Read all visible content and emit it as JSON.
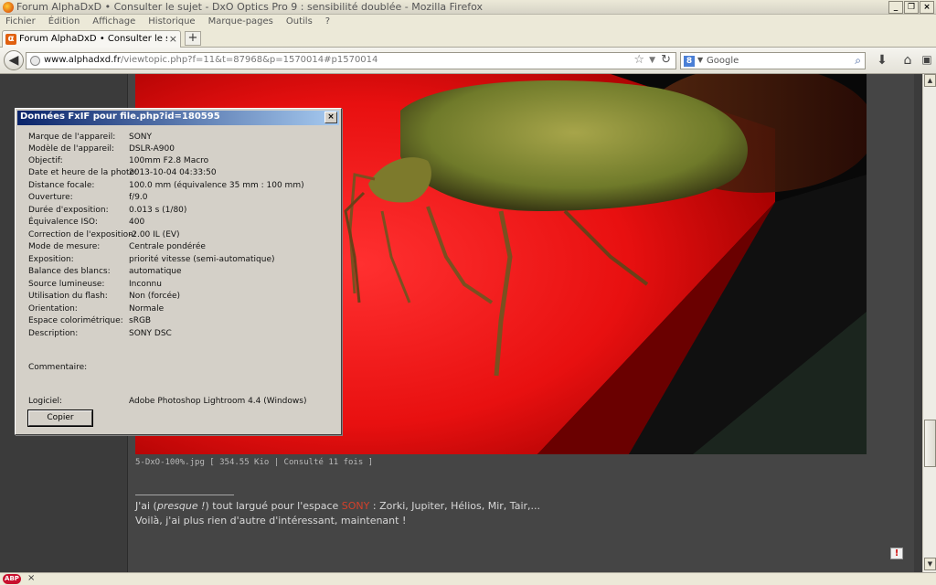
{
  "window": {
    "title": "Forum AlphaDxD • Consulter le sujet - DxO Optics Pro 9 : sensibilité doublée - Mozilla Firefox",
    "min_label": "_",
    "max_label": "❐",
    "close_label": "×"
  },
  "menu": {
    "items": [
      "Fichier",
      "Édition",
      "Affichage",
      "Historique",
      "Marque-pages",
      "Outils",
      "?"
    ]
  },
  "tab": {
    "label": "Forum AlphaDxD • Consulter le sujet - DxO ...",
    "favicon": "α",
    "close": "×",
    "new_tab": "+"
  },
  "nav": {
    "url_domain": "www.alphadxd.fr",
    "url_path": "/viewtopic.php?f=11&t=87968&p=1570014#p1570014",
    "search_engine": "8",
    "search_placeholder": "Google"
  },
  "dialog": {
    "title": "Données FxIF pour file.php?id=180595",
    "close": "×",
    "rows": [
      {
        "label": "Marque de l'appareil:",
        "value": "SONY"
      },
      {
        "label": "Modèle de l'appareil:",
        "value": "DSLR-A900"
      },
      {
        "label": "Objectif:",
        "value": "100mm F2.8 Macro"
      },
      {
        "label": "Date et heure de la photo:",
        "value": "2013-10-04 04:33:50"
      },
      {
        "label": "Distance focale:",
        "value": "100.0 mm (équivalence 35 mm : 100 mm)"
      },
      {
        "label": "Ouverture:",
        "value": "f/9.0"
      },
      {
        "label": "Durée d'exposition:",
        "value": "0.013 s (1/80)"
      },
      {
        "label": "Équivalence ISO:",
        "value": "400"
      },
      {
        "label": "Correction de l'exposition:",
        "value": "-2.00 IL (EV)"
      },
      {
        "label": "Mode de mesure:",
        "value": "Centrale pondérée"
      },
      {
        "label": "Exposition:",
        "value": "priorité vitesse (semi-automatique)"
      },
      {
        "label": "Balance des blancs:",
        "value": "automatique"
      },
      {
        "label": "Source lumineuse:",
        "value": "Inconnu"
      },
      {
        "label": "Utilisation du flash:",
        "value": "Non (forcée)"
      },
      {
        "label": "Orientation:",
        "value": "Normale"
      },
      {
        "label": "Espace colorimétrique:",
        "value": "sRGB"
      },
      {
        "label": "Description:",
        "value": "SONY DSC"
      }
    ],
    "comment_label": "Commentaire:",
    "software_label": "Logiciel:",
    "software_value": "Adobe Photoshop Lightroom 4.4 (Windows)",
    "copy_button": "Copier"
  },
  "post": {
    "caption": "5-DxO-100%.jpg [ 354.55 Kio | Consulté 11 fois ]",
    "sig_pre": "J'ai (",
    "sig_italic": "presque !",
    "sig_mid": ") tout largué pour l'espace ",
    "sig_red": "SONY",
    "sig_post": " : Zorki, Jupiter, Hélios, Mir, Tair,...",
    "sig_line2": "Voilà, j'ai plus rien d'autre d'intéressant, maintenant !",
    "report": "!"
  },
  "status": {
    "abp": "ABP",
    "close": "×"
  },
  "colors": {
    "page_bg": "#454545",
    "accent_red": "#d4402a",
    "dialog_title": "#0a246a"
  }
}
